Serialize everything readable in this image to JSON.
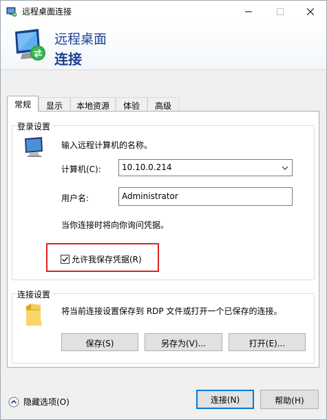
{
  "window": {
    "title": "远程桌面连接",
    "header_line1": "远程桌面",
    "header_line2": "连接"
  },
  "tabs": [
    {
      "label": "常规",
      "active": true
    },
    {
      "label": "显示",
      "active": false
    },
    {
      "label": "本地资源",
      "active": false
    },
    {
      "label": "体验",
      "active": false
    },
    {
      "label": "高级",
      "active": false
    }
  ],
  "logon": {
    "group_title": "登录设置",
    "intro": "输入远程计算机的名称。",
    "computer_label": "计算机(C):",
    "computer_value": "10.10.0.214",
    "user_label": "用户名:",
    "user_value": "Administrator",
    "note": "当你连接时将向你询问凭据。",
    "save_credentials_label": "允许我保存凭据(R)",
    "save_credentials_checked": true
  },
  "connection": {
    "group_title": "连接设置",
    "description": "将当前连接设置保存到 RDP 文件或打开一个已保存的连接。",
    "save_button": "保存(S)",
    "save_as_button": "另存为(V)...",
    "open_button": "打开(E)..."
  },
  "footer": {
    "hide_options": "隐藏选项(O)",
    "connect_button": "连接(N)",
    "help_button": "帮助(H)"
  },
  "colors": {
    "accent": "#0078d7",
    "header_text": "#1c3f94",
    "highlight_box": "#e02020"
  },
  "icons": {
    "app": "remote-desktop-icon",
    "computer": "computer-icon",
    "folder": "folder-icon",
    "hide_options": "chevron-up-circle-icon",
    "combo_arrow": "chevron-down-icon"
  }
}
